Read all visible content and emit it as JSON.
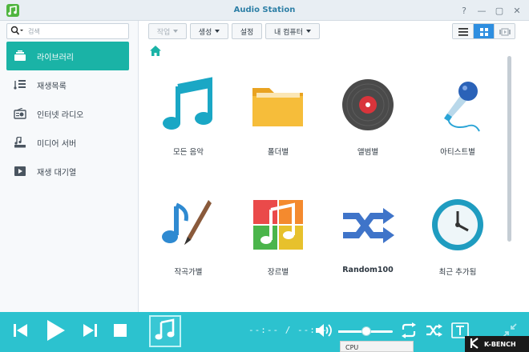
{
  "window": {
    "title": "Audio Station"
  },
  "titlebar": {
    "help_glyph": "?",
    "min_glyph": "—",
    "max_glyph": "▢",
    "close_glyph": "✕"
  },
  "search": {
    "placeholder": "검색"
  },
  "sidebar": {
    "items": [
      {
        "label": "라이브러리",
        "icon": "library-icon",
        "active": true
      },
      {
        "label": "재생목록",
        "icon": "playlist-icon",
        "active": false
      },
      {
        "label": "인터넷 라디오",
        "icon": "radio-icon",
        "active": false
      },
      {
        "label": "미디어 서버",
        "icon": "media-server-icon",
        "active": false
      },
      {
        "label": "재생 대기열",
        "icon": "play-queue-icon",
        "active": false
      }
    ]
  },
  "toolbar": {
    "action_label": "작업",
    "create_label": "생성",
    "settings_label": "설정",
    "my_computer_label": "내 컴퓨터"
  },
  "library": {
    "tiles": [
      {
        "label": "모든 음악",
        "icon": "music-note-icon"
      },
      {
        "label": "폴더별",
        "icon": "folder-icon"
      },
      {
        "label": "앨범별",
        "icon": "vinyl-record-icon"
      },
      {
        "label": "아티스트별",
        "icon": "microphone-icon"
      },
      {
        "label": "작곡가별",
        "icon": "composer-pen-icon"
      },
      {
        "label": "장르별",
        "icon": "genre-icon"
      },
      {
        "label": "Random100",
        "icon": "shuffle-icon"
      },
      {
        "label": "최근 추가됨",
        "icon": "clock-icon"
      }
    ]
  },
  "player": {
    "time": "--:-- / --:--",
    "volume_fraction": 0.52
  },
  "overlay": {
    "brand": "K-BENCH",
    "behind_text": "CPU"
  },
  "colors": {
    "accent": "#1ab3a6",
    "player_bg": "#2cc2cf",
    "title": "#2d7fa6",
    "view_active": "#2e8ee0"
  }
}
